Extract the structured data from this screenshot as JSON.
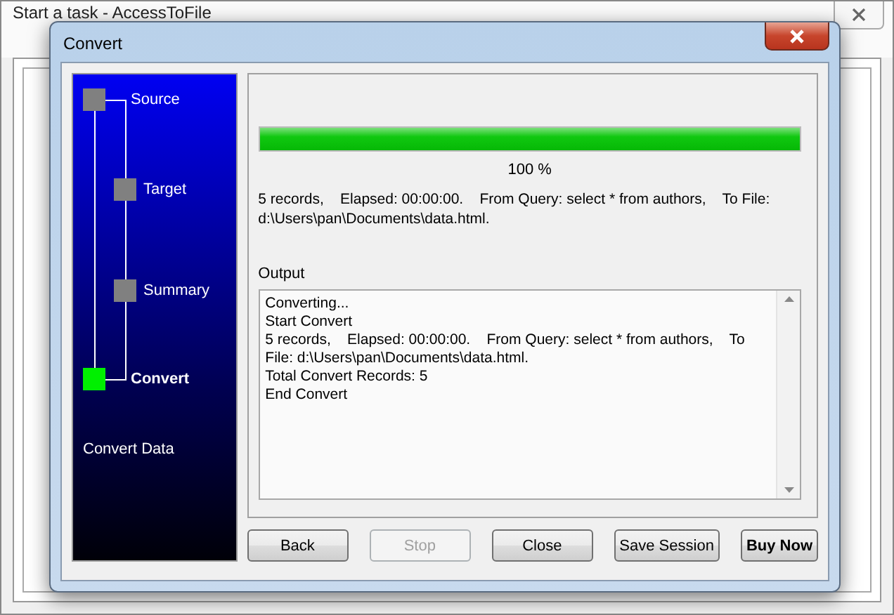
{
  "background_window": {
    "title": "Start a task - AccessToFile"
  },
  "dialog": {
    "title": "Convert"
  },
  "steps": [
    {
      "label": "Source",
      "selected": false,
      "children": [
        {
          "label": "Target",
          "selected": false
        },
        {
          "label": "Summary",
          "selected": false
        }
      ]
    },
    {
      "label": "Convert",
      "selected": true
    }
  ],
  "sidebar_caption": "Convert Data",
  "progress": {
    "level": 1,
    "reading": "100 %"
  },
  "status_text": "5 records,    Elapsed: 00:00:00.    From Query: select * from authors,    To File: d:\\Users\\pan\\Documents\\data.html.",
  "output": {
    "label": "Output",
    "lines": [
      "Converting...",
      "Start Convert",
      "5 records,    Elapsed: 00:00:00.    From Query: select * from authors,    To File: d:\\Users\\pan\\Documents\\data.html.",
      "Total Convert Records: 5",
      "End Convert"
    ]
  },
  "buttons": [
    {
      "label": "Back",
      "disabled": false,
      "bold": false
    },
    {
      "label": "Stop",
      "disabled": true,
      "bold": false
    },
    {
      "label": "Close",
      "disabled": false,
      "bold": false
    },
    {
      "label": "Save Session",
      "disabled": false,
      "bold": false
    },
    {
      "label": "Buy Now",
      "disabled": false,
      "bold": true
    }
  ]
}
